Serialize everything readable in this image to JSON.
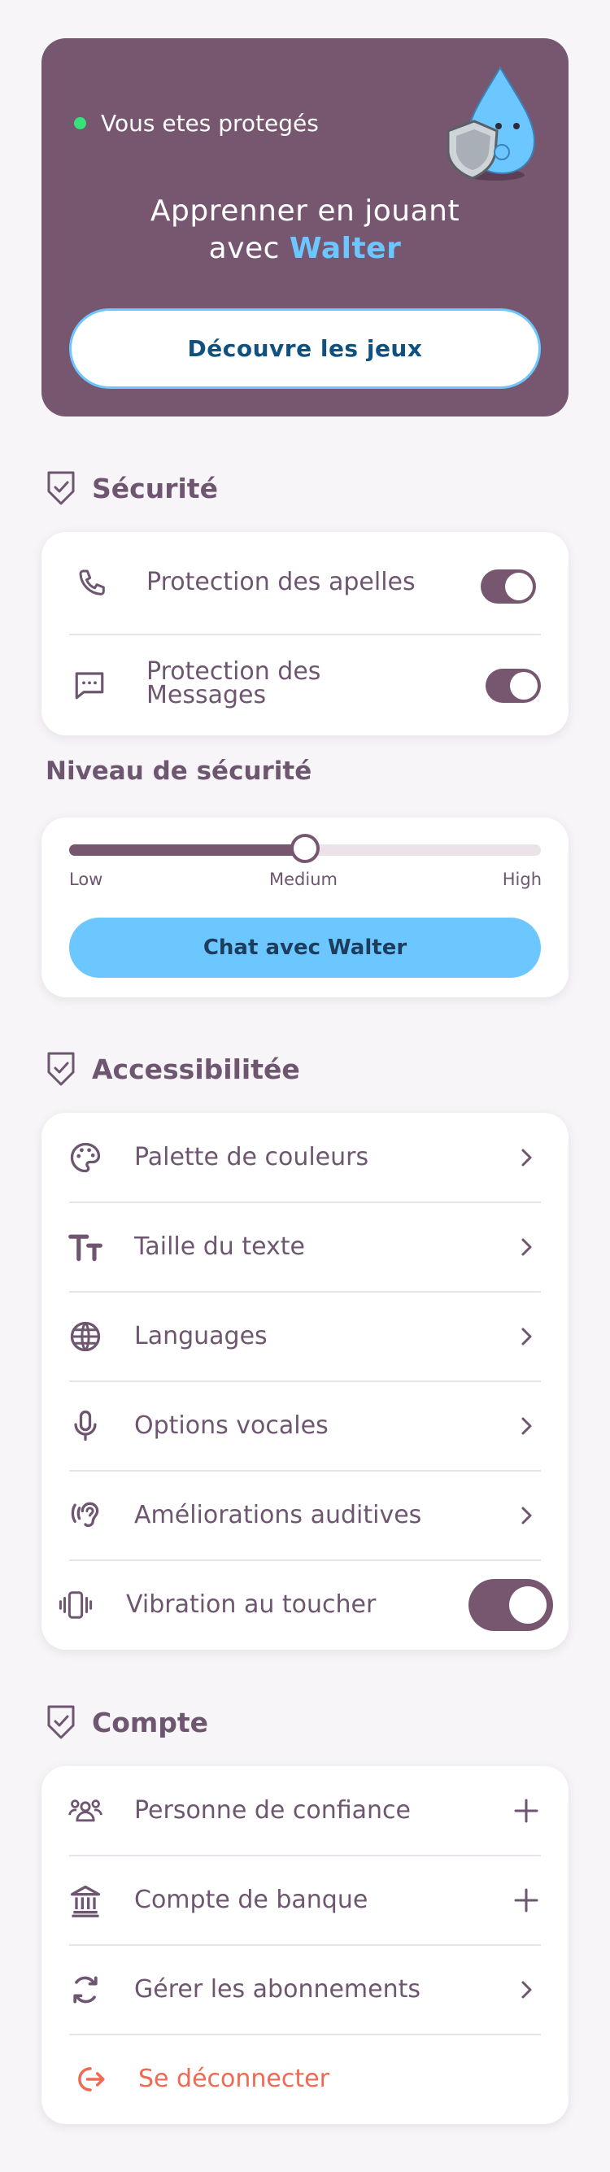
{
  "hero": {
    "status_text": "Vous etes protegés",
    "title_line1": "Apprenner en jouant",
    "title_prefix": "avec ",
    "title_accent": "Walter",
    "cta_label": "Découvre les jeux"
  },
  "security": {
    "heading": "Sécurité",
    "items": [
      {
        "label": "Protection des apelles",
        "icon": "phone-icon",
        "enabled": true
      },
      {
        "label_line1": "Protection des",
        "label_line2": "Messages",
        "icon": "message-icon",
        "enabled": true
      }
    ]
  },
  "security_level": {
    "heading": "Niveau de sécurité",
    "labels": [
      "Low",
      "Medium",
      "High"
    ],
    "value_fraction": 0.5,
    "chat_button": "Chat avec Walter"
  },
  "accessibility": {
    "heading": "Accessibilitée",
    "items": [
      {
        "label": "Palette de couleurs",
        "icon": "palette-icon"
      },
      {
        "label": "Taille du texte",
        "icon": "text-size-icon"
      },
      {
        "label": "Languages",
        "icon": "globe-icon"
      },
      {
        "label": "Options vocales",
        "icon": "microphone-icon"
      },
      {
        "label": "Améliorations auditives",
        "icon": "hearing-icon"
      },
      {
        "label": "Vibration au toucher",
        "icon": "vibration-icon",
        "enabled": true
      }
    ]
  },
  "account": {
    "heading": "Compte",
    "items": [
      {
        "label": "Personne de confiance",
        "icon": "people-icon"
      },
      {
        "label": "Compte de banque",
        "icon": "bank-icon"
      },
      {
        "label": "Gérer les abonnements",
        "icon": "refresh-icon"
      },
      {
        "label": "Se déconnecter",
        "icon": "logout-icon"
      }
    ]
  },
  "colors": {
    "primary": "#77566f",
    "accent": "#6cc6ff",
    "text": "#6e5670",
    "logout": "#ef6a52",
    "status_dot": "#38e27a"
  }
}
